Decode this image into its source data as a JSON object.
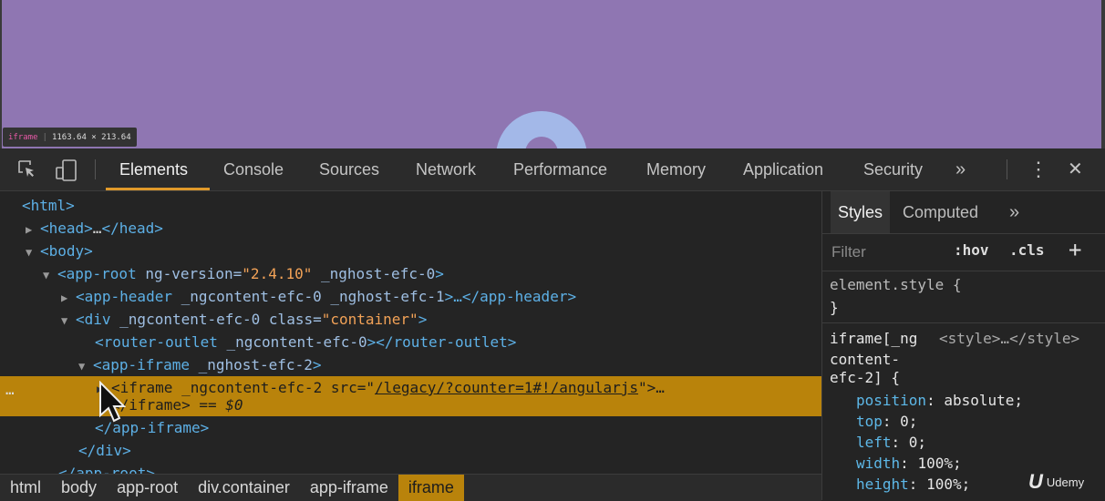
{
  "viewport": {
    "background": "#8f76b2",
    "tooltip": {
      "tag": "iframe",
      "size": "1163.64 × 213.64"
    }
  },
  "toolbar": {
    "tabs": [
      "Elements",
      "Console",
      "Sources",
      "Network",
      "Performance",
      "Memory",
      "Application",
      "Security"
    ],
    "active_tab": "Elements",
    "more": "»",
    "menu": "⋮",
    "close": "✕"
  },
  "dom": {
    "l1": "<html>",
    "l2_open": "<head>",
    "l2_dots": "…",
    "l2_close": "</head>",
    "l3": "<body>",
    "l4_tag": "<app-root",
    "l4_a1n": " ng-version=",
    "l4_a1v": "\"2.4.10\"",
    "l4_a2n": " _nghost-efc-0",
    "l4_end": ">",
    "l5_tag": "<app-header",
    "l5_attrs": " _ngcontent-efc-0 _nghost-efc-1",
    "l5_end": ">…</app-header>",
    "l6_tag": "<div",
    "l6_a1n": " _ngcontent-efc-0 class=",
    "l6_a1v": "\"container\"",
    "l6_end": ">",
    "l7_tag": "<router-outlet",
    "l7_attrs": " _ngcontent-efc-0",
    "l7_end": "></router-outlet>",
    "l8_tag": "<app-iframe",
    "l8_attrs": " _nghost-efc-2",
    "l8_end": ">",
    "l9_tag": "<iframe",
    "l9_a1n": " _ngcontent-efc-2 src=",
    "l9_q1": "\"",
    "l9_a1v": "/legacy/?counter=1#!/angularjs",
    "l9_q2": "\"",
    "l9_end": ">…",
    "l10_tag": "</iframe>",
    "l10_eq": " == $0",
    "l11": "</app-iframe>",
    "l12": "</div>",
    "l13": "</app-root>",
    "row_ellipsis": "…"
  },
  "breadcrumb": [
    "html",
    "body",
    "app-root",
    "div.container",
    "app-iframe",
    "iframe"
  ],
  "styles": {
    "tabs": [
      "Styles",
      "Computed"
    ],
    "more": "»",
    "filter_placeholder": "Filter",
    "hov": ":hov",
    "cls": ".cls",
    "plus": "+",
    "element_style": "element.style {",
    "close_brace": "}",
    "selector1": "iframe[_ng",
    "source": "<style>…</style>",
    "selector2": "content-",
    "selector3": "efc-2] {",
    "props": [
      {
        "name": "position",
        "value": "absolute;"
      },
      {
        "name": "top",
        "value": "0;"
      },
      {
        "name": "left",
        "value": "0;"
      },
      {
        "name": "width",
        "value": "100%;"
      },
      {
        "name": "height",
        "value": "100%;"
      }
    ]
  },
  "watermark": {
    "logo": "U",
    "text": "Udemy"
  },
  "colors": {
    "accent": "#e09a2a",
    "selection": "#b9830b"
  }
}
